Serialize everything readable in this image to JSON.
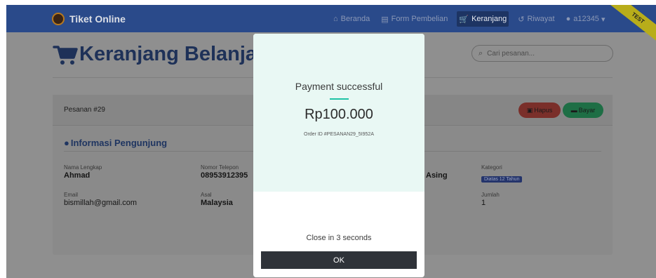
{
  "brand": {
    "name": "Tiket Online"
  },
  "nav": {
    "items": [
      {
        "label": "Beranda",
        "icon": "home-icon",
        "glyph": "⌂"
      },
      {
        "label": "Form Pembelian",
        "icon": "form-icon",
        "glyph": "▤"
      },
      {
        "label": "Keranjang",
        "icon": "cart-icon",
        "glyph": "🛒"
      },
      {
        "label": "Riwayat",
        "icon": "history-icon",
        "glyph": "↺"
      },
      {
        "label": "a12345",
        "icon": "user-icon",
        "glyph": "●",
        "caret": "▾"
      }
    ],
    "active": "Keranjang",
    "ribbon": "TEST"
  },
  "page": {
    "title": "Keranjang Belanja"
  },
  "search": {
    "placeholder": "Cari pesanan...",
    "icon_glyph": "⌕"
  },
  "order": {
    "number_label": "Pesanan #29",
    "delete_label": "Hapus",
    "pay_label": "Bayar",
    "delete_glyph": "▣",
    "pay_glyph": "▬",
    "section_title": "Informasi Pengunjung",
    "section_glyph": "●",
    "fields": {
      "name": {
        "label": "Nama Lengkap",
        "value": "Ahmad"
      },
      "phone": {
        "label": "Nomor Telepon",
        "value": "08953912395"
      },
      "type": {
        "value": "Asing"
      },
      "category": {
        "label": "Kategori",
        "value": "Diatas 12 Tahun"
      },
      "email": {
        "label": "Email",
        "value": "bismillah@gmail.com"
      },
      "origin": {
        "label": "Asal",
        "value": "Malaysia"
      },
      "quantity": {
        "label": "Jumlah",
        "value": "1"
      }
    }
  },
  "modal": {
    "title": "Payment successful",
    "amount": "Rp100.000",
    "order_id": "Order ID #PESANAN29_5I952A",
    "countdown": "Close in 3 seconds",
    "ok_label": "OK"
  },
  "colors": {
    "navbar": "#2a4a8a",
    "accent": "#1fc3a6",
    "title": "#1e3158",
    "delete": "#7a2f2a",
    "pay": "#1e6e45"
  }
}
